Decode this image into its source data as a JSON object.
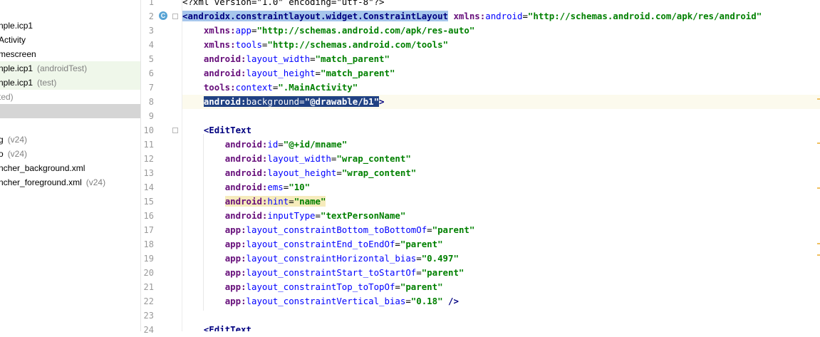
{
  "project_tree": {
    "items": [
      {
        "text": "nple.icp1",
        "suffix": ""
      },
      {
        "text": "Activity",
        "suffix": ""
      },
      {
        "text": "mescreen",
        "suffix": ""
      },
      {
        "text": "nple.icp1",
        "suffix": "(androidTest)"
      },
      {
        "text": "nple.icp1",
        "suffix": "(test)"
      },
      {
        "text": "ted)",
        "suffix": ""
      },
      {
        "text": "",
        "suffix": ""
      },
      {
        "text": "",
        "suffix": ""
      },
      {
        "text": "g",
        "suffix": "(v24)"
      },
      {
        "text": "o",
        "suffix": "(v24)"
      },
      {
        "text": "ncher_background.xml",
        "suffix": ""
      },
      {
        "text": "ncher_foreground.xml",
        "suffix": "(v24)"
      }
    ]
  },
  "gutter": {
    "line_numbers": [
      "1",
      "2",
      "3",
      "4",
      "5",
      "6",
      "7",
      "8",
      "9",
      "10",
      "11",
      "12",
      "13",
      "14",
      "15",
      "16",
      "17",
      "18",
      "19",
      "20",
      "21",
      "22",
      "23",
      "24"
    ],
    "class_icon_letter": "C"
  },
  "editor": {
    "lines": [
      [
        {
          "c": "decl",
          "t": "<?xml version=\"1.0\" encoding=\"utf-8\"?>"
        }
      ],
      [
        {
          "c": "tag",
          "t": "<androidx.constraintlayout.widget.ConstraintLayout",
          "h": "tag"
        },
        {
          "c": "plain",
          "t": " "
        },
        {
          "c": "ns",
          "t": "xmlns:"
        },
        {
          "c": "attr",
          "t": "android"
        },
        {
          "c": "plain",
          "t": "="
        },
        {
          "c": "val",
          "t": "\"http://schemas.android.com/apk/res/android\""
        }
      ],
      [
        {
          "c": "plain",
          "t": "    "
        },
        {
          "c": "ns",
          "t": "xmlns:"
        },
        {
          "c": "attr",
          "t": "app"
        },
        {
          "c": "plain",
          "t": "="
        },
        {
          "c": "val",
          "t": "\"http://schemas.android.com/apk/res-auto\""
        }
      ],
      [
        {
          "c": "plain",
          "t": "    "
        },
        {
          "c": "ns",
          "t": "xmlns:"
        },
        {
          "c": "attr",
          "t": "tools"
        },
        {
          "c": "plain",
          "t": "="
        },
        {
          "c": "val",
          "t": "\"http://schemas.android.com/tools\""
        }
      ],
      [
        {
          "c": "plain",
          "t": "    "
        },
        {
          "c": "ns",
          "t": "android:"
        },
        {
          "c": "attr",
          "t": "layout_width"
        },
        {
          "c": "plain",
          "t": "="
        },
        {
          "c": "val",
          "t": "\"match_parent\""
        }
      ],
      [
        {
          "c": "plain",
          "t": "    "
        },
        {
          "c": "ns",
          "t": "android:"
        },
        {
          "c": "attr",
          "t": "layout_height"
        },
        {
          "c": "plain",
          "t": "="
        },
        {
          "c": "val",
          "t": "\"match_parent\""
        }
      ],
      [
        {
          "c": "plain",
          "t": "    "
        },
        {
          "c": "ns",
          "t": "tools:"
        },
        {
          "c": "attr",
          "t": "context"
        },
        {
          "c": "plain",
          "t": "="
        },
        {
          "c": "val",
          "t": "\".MainActivity\""
        }
      ],
      [
        {
          "c": "plain",
          "t": "    "
        },
        {
          "c": "ns",
          "t": "android:",
          "h": "sel"
        },
        {
          "c": "attr",
          "t": "background",
          "h": "sel"
        },
        {
          "c": "plain",
          "t": "=",
          "h": "sel"
        },
        {
          "c": "val",
          "t": "\"@drawable/b1\"",
          "h": "sel"
        },
        {
          "c": "tag",
          "t": ">"
        }
      ],
      [],
      [
        {
          "c": "plain",
          "t": "    "
        },
        {
          "c": "tag",
          "t": "<EditText"
        }
      ],
      [
        {
          "c": "plain",
          "t": "        "
        },
        {
          "c": "ns",
          "t": "android:"
        },
        {
          "c": "attr",
          "t": "id"
        },
        {
          "c": "plain",
          "t": "="
        },
        {
          "c": "val",
          "t": "\"@+id/mname\""
        }
      ],
      [
        {
          "c": "plain",
          "t": "        "
        },
        {
          "c": "ns",
          "t": "android:"
        },
        {
          "c": "attr",
          "t": "layout_width"
        },
        {
          "c": "plain",
          "t": "="
        },
        {
          "c": "val",
          "t": "\"wrap_content\""
        }
      ],
      [
        {
          "c": "plain",
          "t": "        "
        },
        {
          "c": "ns",
          "t": "android:"
        },
        {
          "c": "attr",
          "t": "layout_height"
        },
        {
          "c": "plain",
          "t": "="
        },
        {
          "c": "val",
          "t": "\"wrap_content\""
        }
      ],
      [
        {
          "c": "plain",
          "t": "        "
        },
        {
          "c": "ns",
          "t": "android:"
        },
        {
          "c": "attr",
          "t": "ems"
        },
        {
          "c": "plain",
          "t": "="
        },
        {
          "c": "val",
          "t": "\"10\""
        }
      ],
      [
        {
          "c": "plain",
          "t": "        "
        },
        {
          "c": "ns",
          "t": "android:",
          "h": "warn"
        },
        {
          "c": "attr",
          "t": "hint",
          "h": "warn"
        },
        {
          "c": "plain",
          "t": "=",
          "h": "warn"
        },
        {
          "c": "val",
          "t": "\"name\"",
          "h": "warn"
        }
      ],
      [
        {
          "c": "plain",
          "t": "        "
        },
        {
          "c": "ns",
          "t": "android:"
        },
        {
          "c": "attr",
          "t": "inputType"
        },
        {
          "c": "plain",
          "t": "="
        },
        {
          "c": "val",
          "t": "\"textPersonName\""
        }
      ],
      [
        {
          "c": "plain",
          "t": "        "
        },
        {
          "c": "ns",
          "t": "app:"
        },
        {
          "c": "attr",
          "t": "layout_constraintBottom_toBottomOf"
        },
        {
          "c": "plain",
          "t": "="
        },
        {
          "c": "val",
          "t": "\"parent\""
        }
      ],
      [
        {
          "c": "plain",
          "t": "        "
        },
        {
          "c": "ns",
          "t": "app:"
        },
        {
          "c": "attr",
          "t": "layout_constraintEnd_toEndOf"
        },
        {
          "c": "plain",
          "t": "="
        },
        {
          "c": "val",
          "t": "\"parent\""
        }
      ],
      [
        {
          "c": "plain",
          "t": "        "
        },
        {
          "c": "ns",
          "t": "app:"
        },
        {
          "c": "attr",
          "t": "layout_constraintHorizontal_bias"
        },
        {
          "c": "plain",
          "t": "="
        },
        {
          "c": "val",
          "t": "\"0.497\""
        }
      ],
      [
        {
          "c": "plain",
          "t": "        "
        },
        {
          "c": "ns",
          "t": "app:"
        },
        {
          "c": "attr",
          "t": "layout_constraintStart_toStartOf"
        },
        {
          "c": "plain",
          "t": "="
        },
        {
          "c": "val",
          "t": "\"parent\""
        }
      ],
      [
        {
          "c": "plain",
          "t": "        "
        },
        {
          "c": "ns",
          "t": "app:"
        },
        {
          "c": "attr",
          "t": "layout_constraintTop_toTopOf"
        },
        {
          "c": "plain",
          "t": "="
        },
        {
          "c": "val",
          "t": "\"parent\""
        }
      ],
      [
        {
          "c": "plain",
          "t": "        "
        },
        {
          "c": "ns",
          "t": "app:"
        },
        {
          "c": "attr",
          "t": "layout_constraintVertical_bias"
        },
        {
          "c": "plain",
          "t": "="
        },
        {
          "c": "val",
          "t": "\"0.18\""
        },
        {
          "c": "tag",
          "t": " />"
        }
      ],
      [],
      [
        {
          "c": "plain",
          "t": "    "
        },
        {
          "c": "tag",
          "t": "<EditText"
        }
      ]
    ]
  },
  "colors": {
    "tag": "#000080",
    "namespace": "#660e7a",
    "attribute": "#0000ff",
    "value": "#008000",
    "selection": "#214283",
    "tag_highlight": "#a6c6ec",
    "warning_highlight": "#f6ebbc",
    "current_line": "#fcfaed"
  }
}
